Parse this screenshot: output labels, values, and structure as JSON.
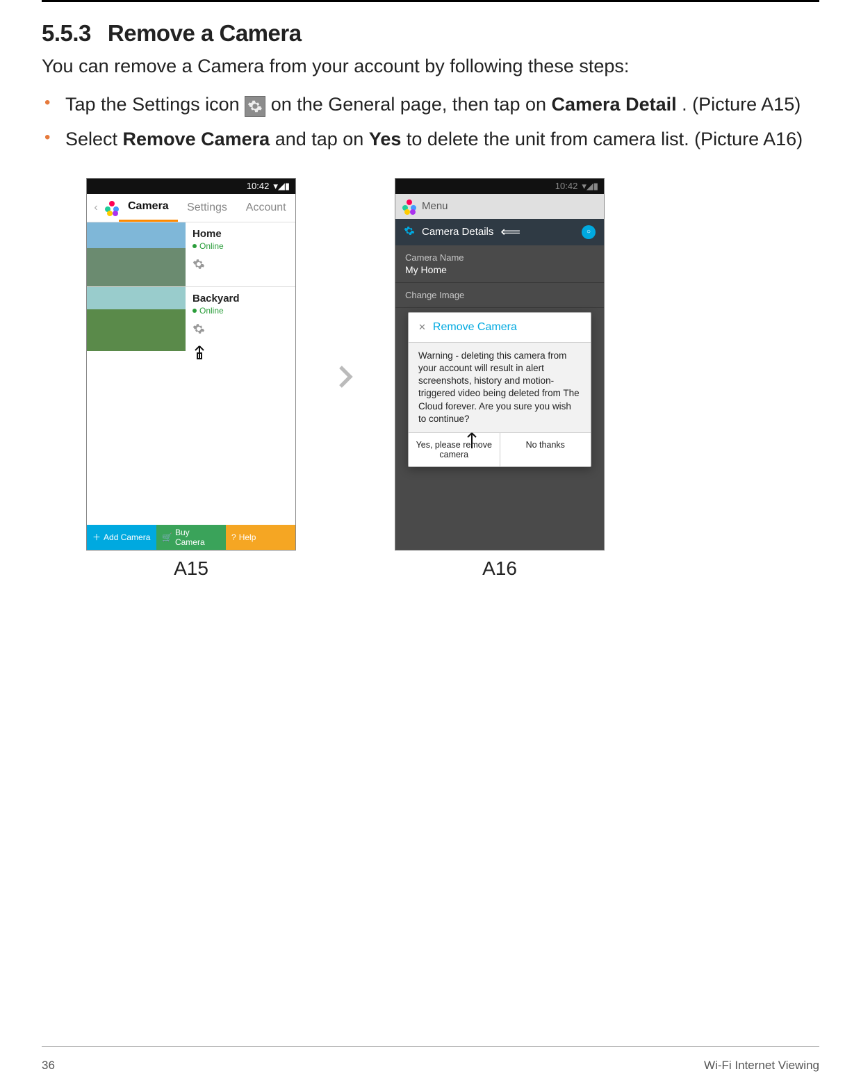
{
  "section": {
    "number": "5.5.3",
    "title": "Remove a Camera"
  },
  "intro": "You can remove a Camera from your account by following these steps:",
  "steps": {
    "s1_a": "Tap the Settings icon ",
    "s1_b": " on the General page, then tap on ",
    "s1_bold": "Camera Detail",
    "s1_c": ". (Picture A15)",
    "s2_a": "Select ",
    "s2_bold1": "Remove Camera",
    "s2_b": " and tap on ",
    "s2_bold2": "Yes",
    "s2_c": " to delete the unit from camera list. (Picture A16)"
  },
  "phoneA15": {
    "time": "10:42",
    "tabs": {
      "camera": "Camera",
      "settings": "Settings",
      "account": "Account"
    },
    "cams": [
      {
        "name": "Home",
        "status": "Online"
      },
      {
        "name": "Backyard",
        "status": "Online"
      }
    ],
    "bottom": {
      "add": "Add Camera",
      "buy": "Buy Camera",
      "help": "Help"
    }
  },
  "phoneA16": {
    "time": "10:42",
    "menu": "Menu",
    "camDetails": "Camera Details",
    "camNameLabel": "Camera Name",
    "camNameValue": "My Home",
    "changeImage": "Change Image",
    "dialog": {
      "title": "Remove Camera",
      "body": "Warning - deleting this camera from your account will result in alert screenshots, history and motion-triggered video being deleted from The Cloud forever. Are you sure you wish to continue?",
      "yes": "Yes, please remove camera",
      "no": "No thanks"
    }
  },
  "captions": {
    "a15": "A15",
    "a16": "A16"
  },
  "footer": {
    "page": "36",
    "title": "Wi-Fi Internet Viewing"
  }
}
